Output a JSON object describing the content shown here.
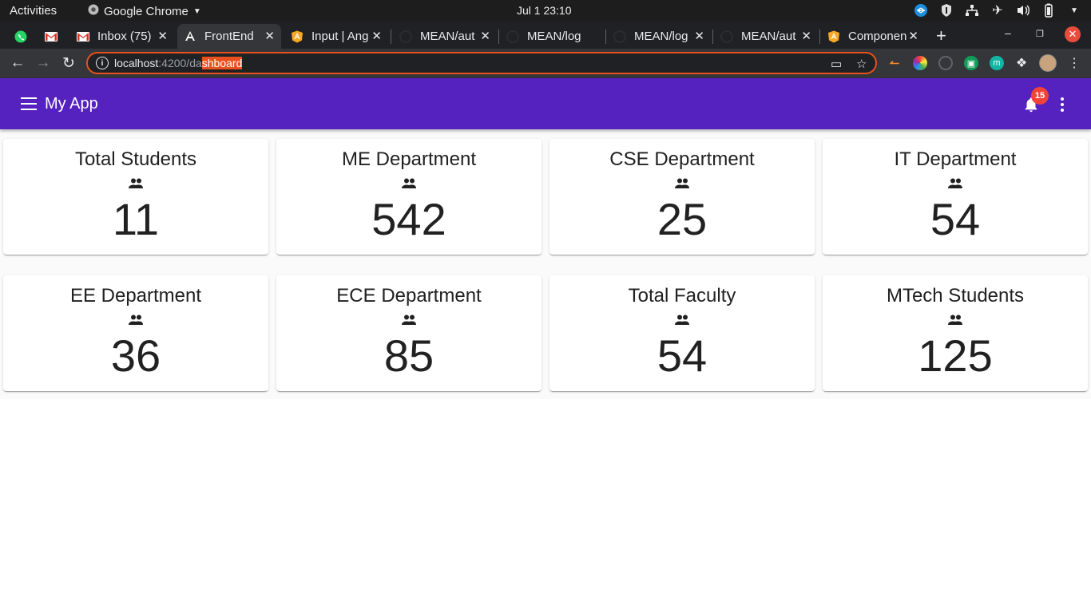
{
  "os_bar": {
    "activities": "Activities",
    "app_name": "Google Chrome",
    "clock": "Jul 1  23:10"
  },
  "browser": {
    "tabs": [
      {
        "title": "",
        "icon": "whatsapp-icon"
      },
      {
        "title": "",
        "icon": "gmail-icon"
      },
      {
        "title": "Inbox (75)",
        "icon": "gmail-icon"
      },
      {
        "title": "FrontEnd",
        "icon": "angular-icon"
      },
      {
        "title": "Input | Ang",
        "icon": "angular-material-icon"
      },
      {
        "title": "MEAN/aut",
        "icon": "github-icon"
      },
      {
        "title": "MEAN/log",
        "icon": "github-icon"
      },
      {
        "title": "MEAN/log",
        "icon": "github-icon"
      },
      {
        "title": "MEAN/aut",
        "icon": "github-icon"
      },
      {
        "title": "Componen",
        "icon": "angular-material-icon"
      }
    ],
    "url": {
      "host": "localhost",
      "port_path": ":4200/da",
      "selected": "shboard"
    },
    "colors": {
      "omnibox_border": "#e8501e"
    }
  },
  "app": {
    "title": "My App",
    "notification_count": "15",
    "header_color": "#5522bf"
  },
  "cards": [
    {
      "title": "Total Students",
      "value": "11"
    },
    {
      "title": "ME Department",
      "value": "542"
    },
    {
      "title": "CSE Department",
      "value": "25"
    },
    {
      "title": "IT Department",
      "value": "54"
    },
    {
      "title": "EE Department",
      "value": "36"
    },
    {
      "title": "ECE Department",
      "value": "85"
    },
    {
      "title": "Total Faculty",
      "value": "54"
    },
    {
      "title": "MTech Students",
      "value": "125"
    }
  ]
}
